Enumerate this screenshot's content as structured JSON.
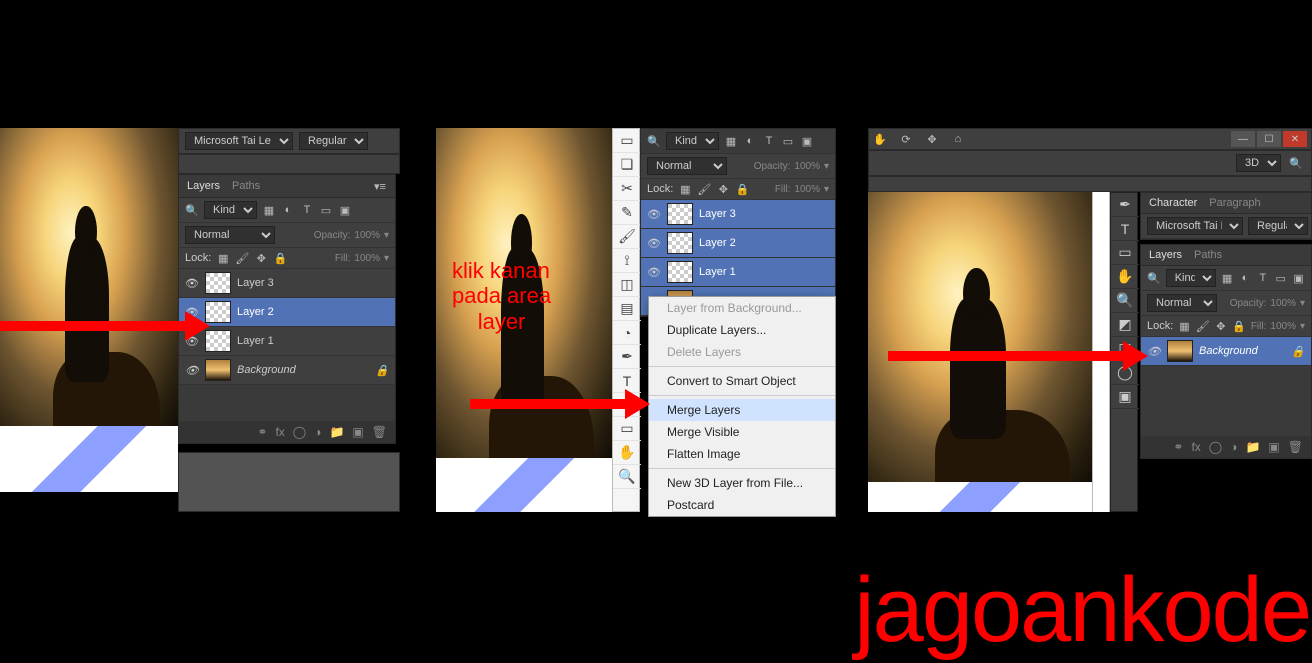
{
  "watermark": "jagoankode",
  "annotation": {
    "line1": "klik kanan",
    "line2": "pada area",
    "line3": "layer"
  },
  "options_bar": {
    "font_family": "Microsoft Tai Le",
    "font_style": "Regular"
  },
  "layers_panel": {
    "tab_layers": "Layers",
    "tab_paths": "Paths",
    "filter_label": "Kind",
    "blend_mode": "Normal",
    "opacity_label": "Opacity:",
    "opacity_value": "100%",
    "lock_label": "Lock:",
    "fill_label": "Fill:",
    "fill_value": "100%",
    "layers": [
      {
        "name": "Layer 3"
      },
      {
        "name": "Layer 2"
      },
      {
        "name": "Layer 1"
      },
      {
        "name": "Background"
      }
    ]
  },
  "context_menu": {
    "layer_from_bg": "Layer from Background...",
    "duplicate": "Duplicate Layers...",
    "delete": "Delete Layers",
    "convert_smart": "Convert to Smart Object",
    "merge_layers": "Merge Layers",
    "merge_visible": "Merge Visible",
    "flatten": "Flatten Image",
    "new_3d": "New 3D Layer from File...",
    "postcard": "Postcard"
  },
  "panel3": {
    "tab_character": "Character",
    "tab_paragraph": "Paragraph",
    "font_family": "Microsoft Tai Le",
    "font_style": "Regular",
    "threeD_label": "3D",
    "bg_layer": "Background"
  }
}
